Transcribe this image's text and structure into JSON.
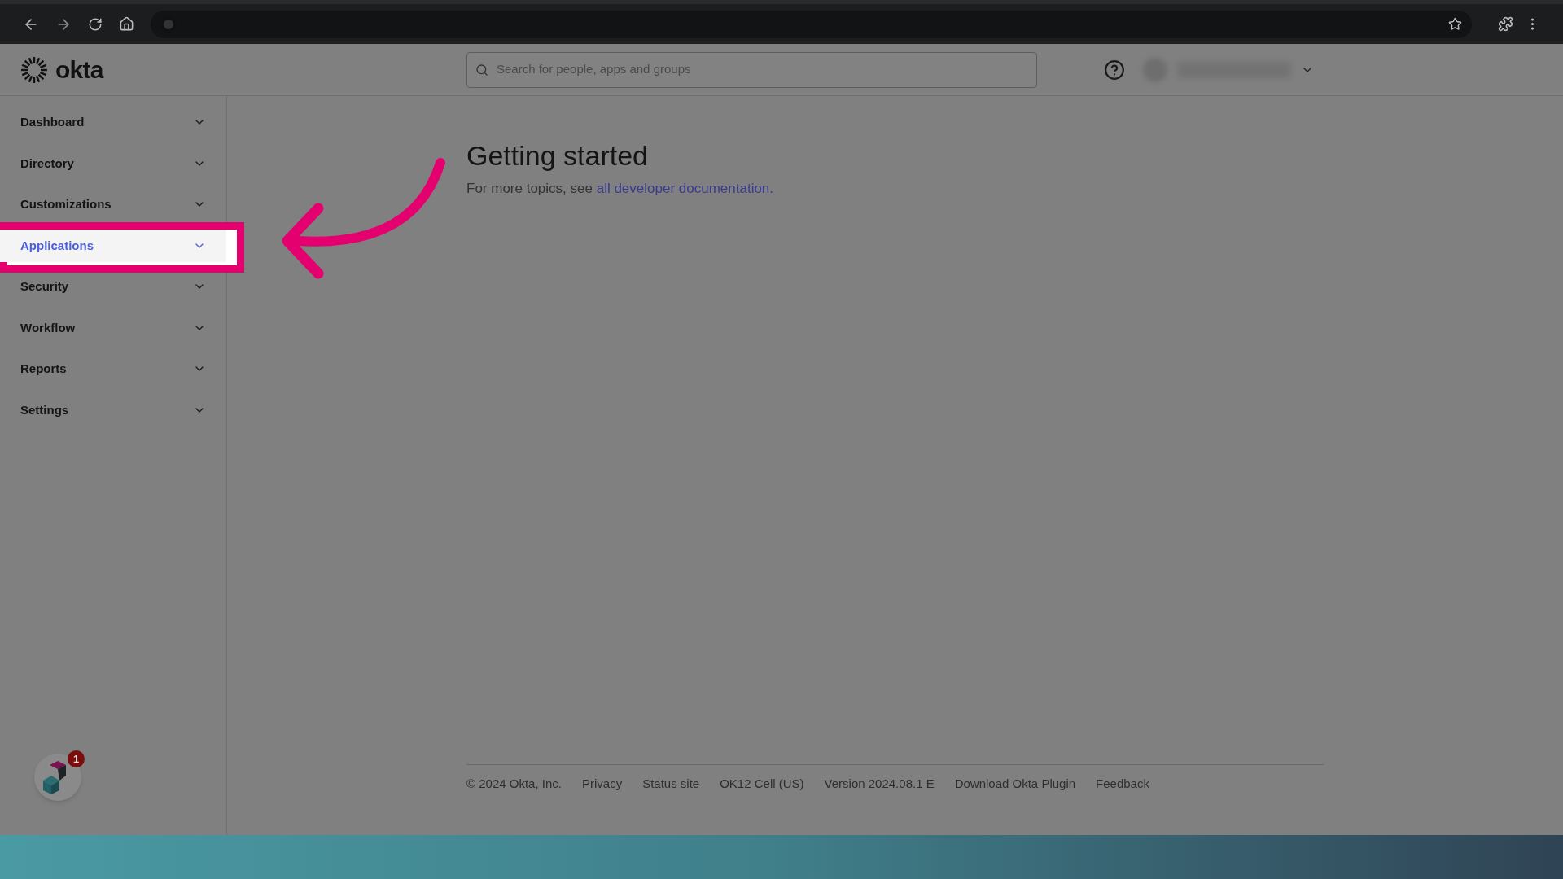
{
  "header": {
    "logo": "okta",
    "search": {
      "placeholder": "Search for people, apps and groups"
    }
  },
  "sidebar": {
    "items": [
      {
        "label": "Dashboard",
        "selected": false,
        "highlighted": false
      },
      {
        "label": "Directory",
        "selected": false,
        "highlighted": false
      },
      {
        "label": "Customizations",
        "selected": false,
        "highlighted": false
      },
      {
        "label": "Applications",
        "selected": true,
        "highlighted": true
      },
      {
        "label": "Security",
        "selected": false,
        "highlighted": false
      },
      {
        "label": "Workflow",
        "selected": false,
        "highlighted": false
      },
      {
        "label": "Reports",
        "selected": false,
        "highlighted": false
      },
      {
        "label": "Settings",
        "selected": false,
        "highlighted": false
      }
    ]
  },
  "main": {
    "title": "Getting started",
    "intro": "For more topics, see",
    "link": "all developer documentation."
  },
  "footer": {
    "links": [
      {
        "label": "© 2024 Okta, Inc."
      },
      {
        "label": "Privacy"
      },
      {
        "label": "Status site"
      },
      {
        "label": "OK12 Cell (US)"
      },
      {
        "label": "Version 2024.08.1 E"
      },
      {
        "label": "Download Okta Plugin"
      },
      {
        "label": "Feedback"
      }
    ]
  },
  "widget": {
    "badge": "1"
  }
}
